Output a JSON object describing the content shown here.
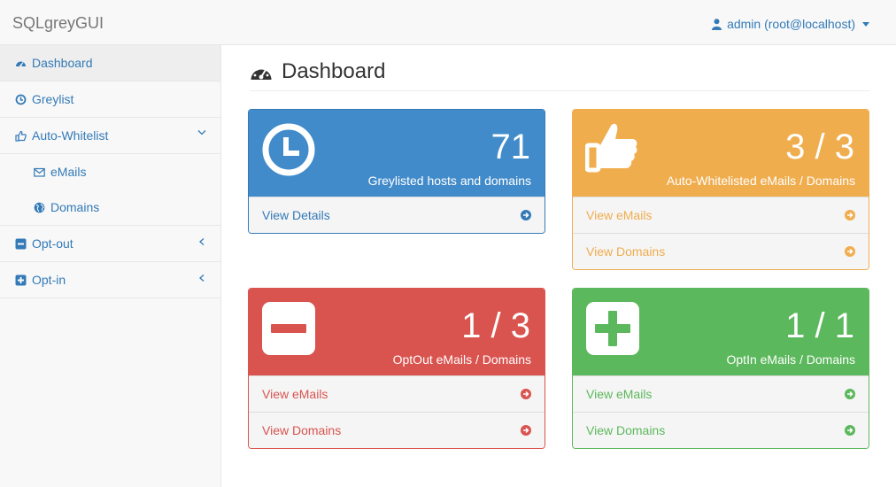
{
  "app": {
    "brand": "SQLgreyGUI"
  },
  "user": {
    "label": "admin (root@localhost)"
  },
  "sidebar": {
    "items": [
      {
        "label": "Dashboard",
        "icon": "dashboard-icon"
      },
      {
        "label": "Greylist",
        "icon": "clock-icon"
      },
      {
        "label": "Auto-Whitelist",
        "icon": "thumbs-up-icon"
      },
      {
        "label": "eMails",
        "icon": "envelope-icon"
      },
      {
        "label": "Domains",
        "icon": "globe-icon"
      },
      {
        "label": "Opt-out",
        "icon": "minus-square-icon"
      },
      {
        "label": "Opt-in",
        "icon": "plus-square-icon"
      }
    ]
  },
  "page": {
    "title": "Dashboard"
  },
  "panels": {
    "greylist": {
      "count": "71",
      "caption": "Greylisted hosts and domains",
      "links": [
        "View Details"
      ]
    },
    "whitelist": {
      "count": "3 / 3",
      "caption": "Auto-Whitelisted eMails / Domains",
      "links": [
        "View eMails",
        "View Domains"
      ]
    },
    "optout": {
      "count": "1 / 3",
      "caption": "OptOut eMails / Domains",
      "links": [
        "View eMails",
        "View Domains"
      ]
    },
    "optin": {
      "count": "1 / 1",
      "caption": "OptIn eMails / Domains",
      "links": [
        "View eMails",
        "View Domains"
      ]
    }
  },
  "colors": {
    "blue": "#428bca",
    "yellow": "#f0ad4e",
    "red": "#d9534f",
    "green": "#5cb85c",
    "link": "#337ab7"
  }
}
